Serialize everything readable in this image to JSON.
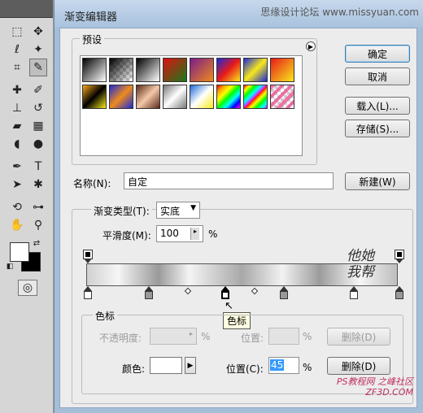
{
  "window": {
    "title": "渐变编辑器",
    "watermark": "思缘设计论坛 www.missyuan.com"
  },
  "buttons": {
    "ok": "确定",
    "cancel": "取消",
    "load": "载入(L)...",
    "save": "存储(S)...",
    "new": "新建(W)"
  },
  "presets": {
    "label": "预设"
  },
  "name": {
    "label": "名称(N):",
    "value": "自定"
  },
  "gradient": {
    "type_label": "渐变类型(T):",
    "type_value": "实底",
    "smooth_label": "平滑度(M):",
    "smooth_value": "100",
    "smooth_unit": "%"
  },
  "stops": {
    "label": "色标",
    "opacity_label": "不透明度:",
    "opacity_value": "",
    "opacity_unit": "%",
    "opacity_location_label": "位置:",
    "opacity_location_unit": "%",
    "opacity_delete": "删除(D)",
    "color_label": "颜色:",
    "location_label": "位置(C):",
    "location_value": "45",
    "location_unit": "%",
    "delete": "删除(D)"
  },
  "tooltip": "色标",
  "signature": "他她我帮",
  "watermark_bottom": "PS教程网 之峰社区 ZF3D.COM",
  "colors": {
    "accent": "#3c7fb1",
    "title_bg": "#a9c2de"
  }
}
